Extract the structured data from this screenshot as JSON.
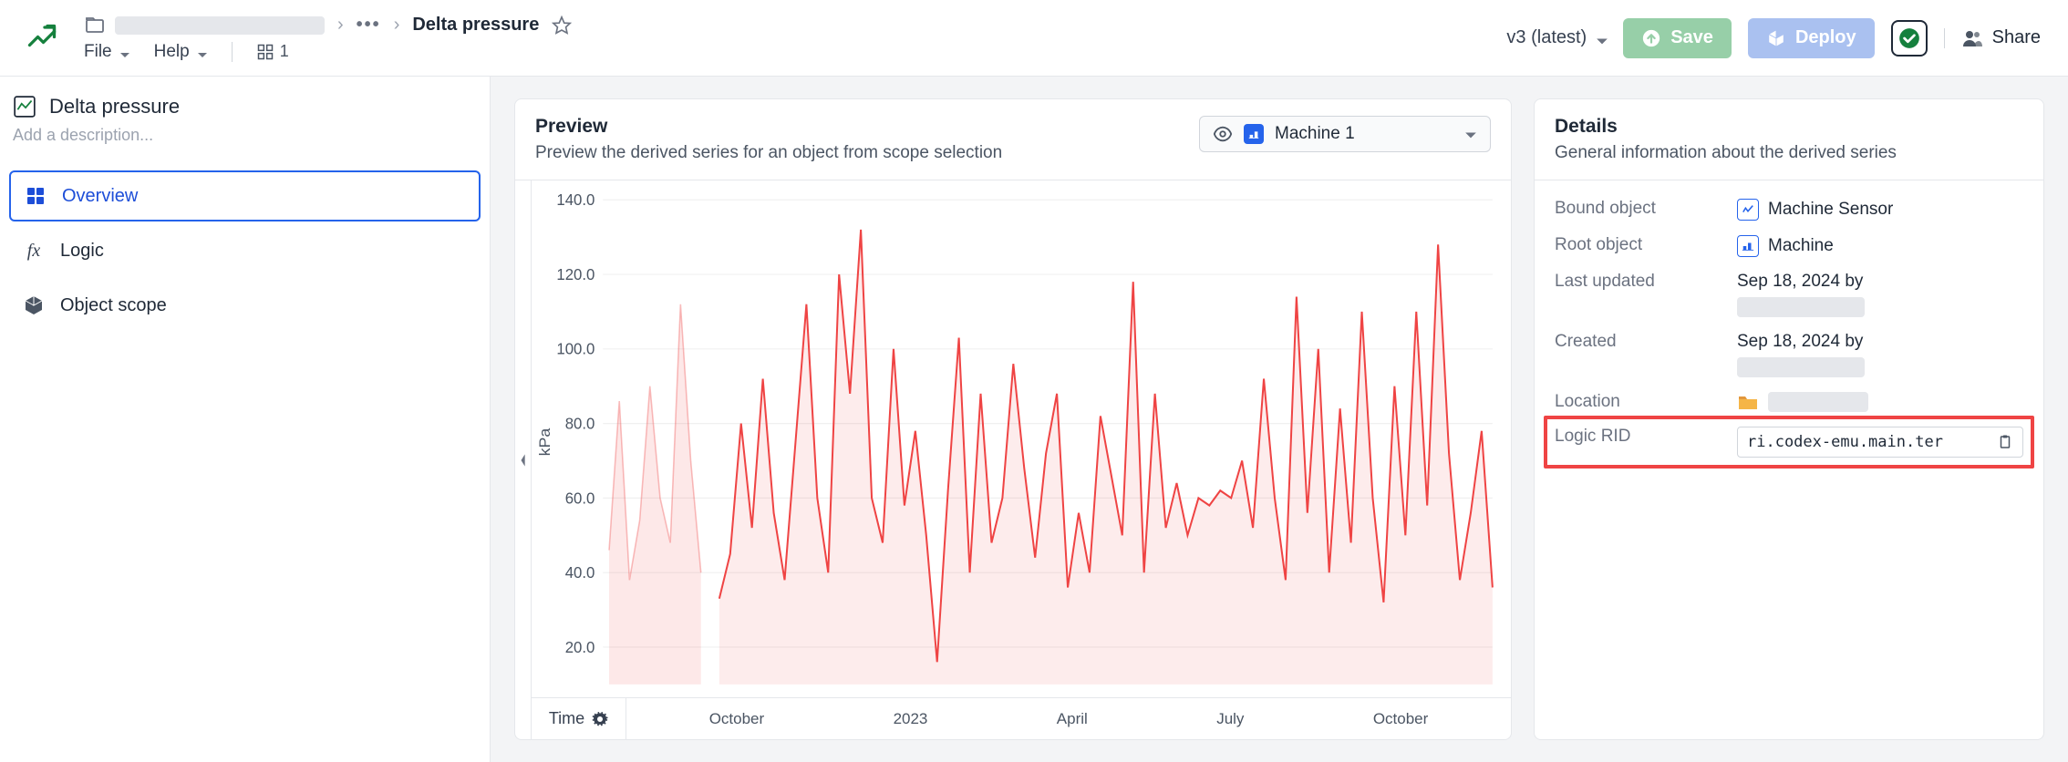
{
  "header": {
    "breadcrumb_title": "Delta pressure",
    "file_menu": "File",
    "help_menu": "Help",
    "count": "1",
    "version": "v3 (latest)",
    "save": "Save",
    "deploy": "Deploy",
    "share": "Share"
  },
  "sidebar": {
    "title": "Delta pressure",
    "desc_placeholder": "Add a description...",
    "items": [
      "Overview",
      "Logic",
      "Object scope"
    ]
  },
  "preview": {
    "title": "Preview",
    "subtitle": "Preview the derived series for an object from scope selection",
    "selected_object": "Machine 1",
    "y_unit": "kPa",
    "time_label": "Time"
  },
  "details_panel": {
    "title": "Details",
    "subtitle": "General information about the derived series",
    "rows": {
      "bound_object_label": "Bound object",
      "bound_object_value": "Machine Sensor",
      "root_object_label": "Root object",
      "root_object_value": "Machine",
      "last_updated_label": "Last updated",
      "last_updated_value": "Sep 18, 2024 by",
      "created_label": "Created",
      "created_value": "Sep 18, 2024 by",
      "location_label": "Location",
      "logic_rid_label": "Logic RID",
      "logic_rid_value": "ri.codex-emu.main.ter"
    }
  },
  "chart_data": {
    "type": "line",
    "ylabel": "kPa",
    "ylim": [
      10,
      140
    ],
    "yticks": [
      20,
      40,
      60,
      80,
      100,
      120,
      140
    ],
    "xticks": [
      "October",
      "2023",
      "April",
      "July",
      "October"
    ],
    "values": [
      33,
      45,
      80,
      52,
      92,
      56,
      38,
      75,
      112,
      60,
      40,
      120,
      88,
      132,
      60,
      48,
      100,
      58,
      78,
      50,
      16,
      62,
      103,
      40,
      88,
      48,
      60,
      96,
      68,
      44,
      72,
      88,
      36,
      56,
      40,
      82,
      66,
      50,
      118,
      40,
      88,
      52,
      64,
      50,
      60,
      58,
      62,
      60,
      70,
      52,
      92,
      60,
      38,
      114,
      56,
      100,
      40,
      84,
      48,
      110,
      60,
      32,
      90,
      50,
      110,
      58,
      128,
      72,
      38,
      56,
      78,
      36
    ],
    "pre_values": [
      46,
      86,
      38,
      54,
      90,
      60,
      48,
      112,
      70,
      40
    ],
    "title": ""
  }
}
